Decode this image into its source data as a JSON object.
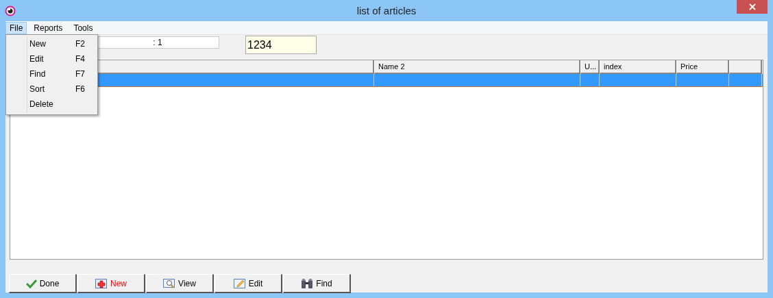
{
  "window": {
    "title": "list of articles"
  },
  "menu": [
    {
      "label": "File",
      "selected": true
    },
    {
      "label": "Reports",
      "selected": false
    },
    {
      "label": "Tools",
      "selected": false
    }
  ],
  "dropdown": [
    {
      "label": "New",
      "shortcut": "F2"
    },
    {
      "label": "Edit",
      "shortcut": "F4"
    },
    {
      "label": "Find",
      "shortcut": "F7"
    },
    {
      "label": "Sort",
      "shortcut": "F6"
    },
    {
      "label": "Delete"
    }
  ],
  "fields": {
    "counter": {
      "value": ": 1"
    },
    "code": {
      "value": "1234"
    }
  },
  "table": {
    "columns": [
      "",
      "Name 2",
      "U...",
      "index",
      "Price",
      ""
    ],
    "rows": [
      {
        "selected": true,
        "cells": [
          "",
          "",
          "",
          "",
          "",
          ""
        ]
      }
    ]
  },
  "buttons": [
    {
      "label": "Done",
      "kind": "done",
      "color": "#000000"
    },
    {
      "label": "New",
      "kind": "new",
      "color": "#ff0000"
    },
    {
      "label": "View",
      "kind": "view",
      "color": "#000000"
    },
    {
      "label": "Edit",
      "kind": "edit",
      "color": "#000000"
    },
    {
      "label": "Find",
      "kind": "find",
      "color": "#000000"
    }
  ]
}
